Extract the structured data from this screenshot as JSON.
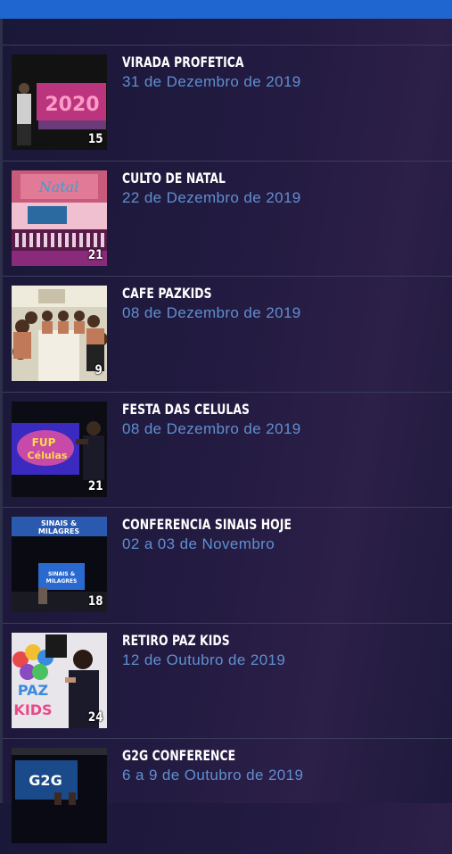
{
  "colors": {
    "header_bar": "#1f66d0",
    "title_text": "#ffffff",
    "date_text": "#5f8fd0"
  },
  "events": [
    {
      "title": "VIRADA PROFETICA",
      "date": "31 de Dezembro de 2019",
      "photo_count": "15",
      "thumbnail": "stage with 2020 screen"
    },
    {
      "title": "CULTO DE NATAL",
      "date": "22 de Dezembro de 2019",
      "photo_count": "21",
      "thumbnail": "christmas stage with choir"
    },
    {
      "title": "CAFE PAZKIDS",
      "date": "08 de Dezembro de 2019",
      "photo_count": "9",
      "thumbnail": "group at a table"
    },
    {
      "title": "FESTA DAS CELULAS",
      "date": "08 de Dezembro de 2019",
      "photo_count": "21",
      "thumbnail": "singer and screen"
    },
    {
      "title": "CONFERENCIA SINAIS HOJE",
      "date": "02 a 03 de Novembro",
      "photo_count": "18",
      "thumbnail": "conference stage"
    },
    {
      "title": "RETIRO PAZ KIDS",
      "date": "12 de Outubro de 2019",
      "photo_count": "24",
      "thumbnail": "balloons paz kids"
    },
    {
      "title": "G2G CONFERENCE",
      "date": "6 a 9 de Outubro de 2019",
      "photo_count": "",
      "thumbnail": "g2g stage"
    }
  ]
}
